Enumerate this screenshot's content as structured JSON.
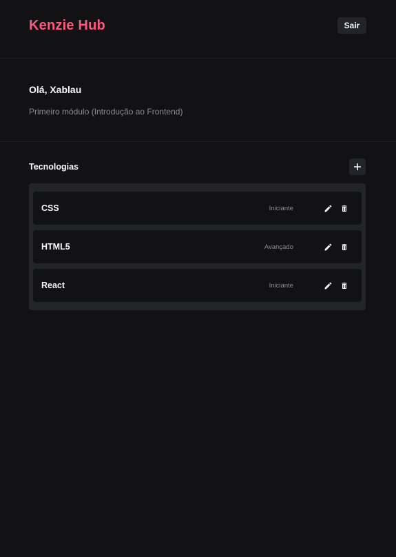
{
  "header": {
    "logo": "Kenzie Hub",
    "logout_label": "Sair"
  },
  "profile": {
    "greeting": "Olá, Xablau",
    "module": "Primeiro módulo (Introdução ao Frontend)"
  },
  "technologies": {
    "title": "Tecnologias",
    "add_icon": "plus-icon",
    "items": [
      {
        "name": "CSS",
        "status": "Iniciante",
        "edit_icon": "pencil-icon",
        "delete_icon": "trash-icon"
      },
      {
        "name": "HTML5",
        "status": "Avançado",
        "edit_icon": "pencil-icon",
        "delete_icon": "trash-icon"
      },
      {
        "name": "React",
        "status": "Iniciante",
        "edit_icon": "pencil-icon",
        "delete_icon": "trash-icon"
      }
    ]
  },
  "colors": {
    "brand": "#FF577F",
    "background": "#121214",
    "surface": "#212529",
    "text": "#F8F9FA",
    "muted": "#868E96"
  }
}
